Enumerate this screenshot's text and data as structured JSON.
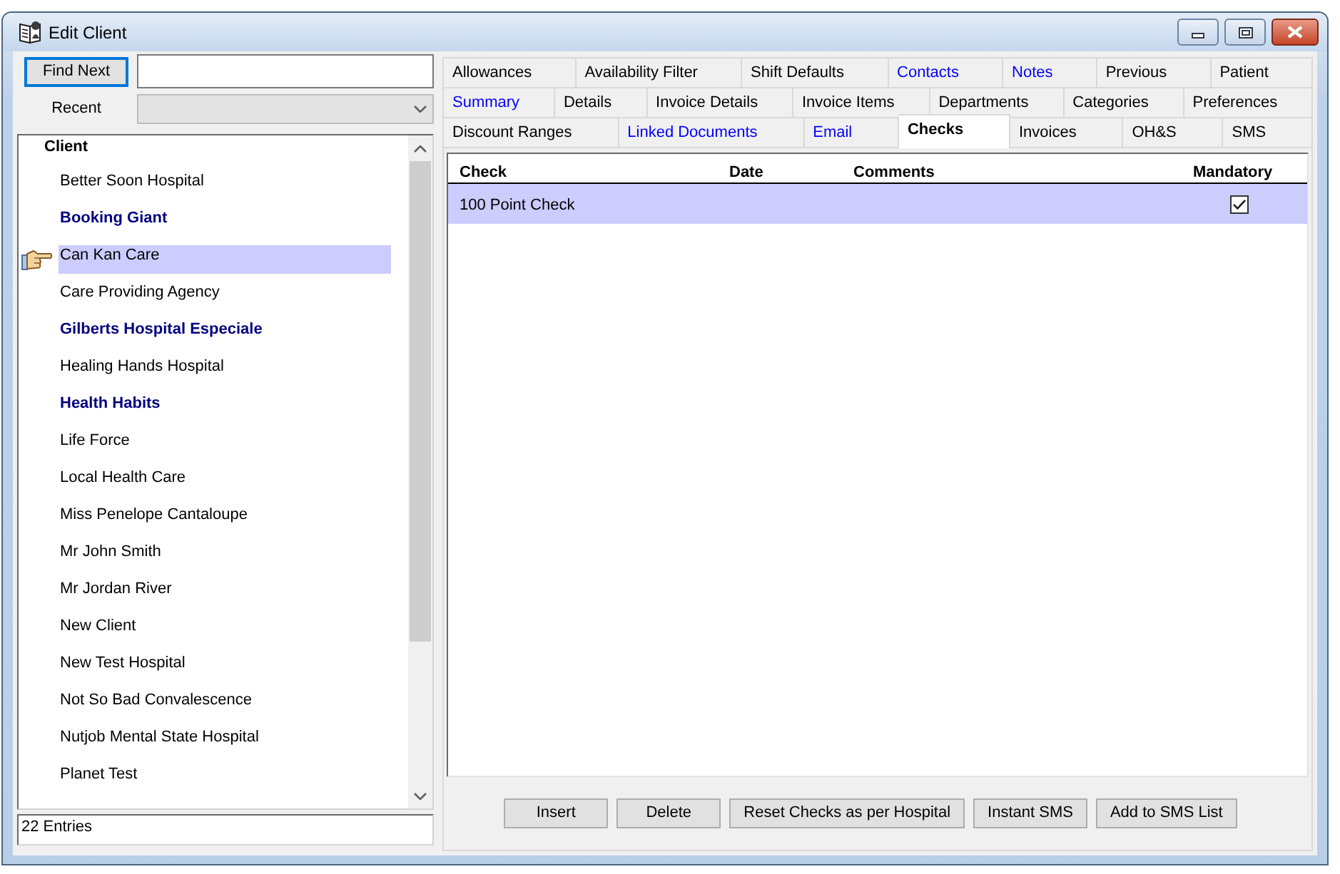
{
  "window": {
    "title": "Edit Client"
  },
  "search": {
    "button_label": "Find Next",
    "focused": true
  },
  "recent": {
    "label": "Recent",
    "disabled": true
  },
  "client_list": {
    "header": "Client",
    "items": [
      {
        "name": "Better Soon Hospital",
        "emphasized": false,
        "selected": false
      },
      {
        "name": "Booking Giant",
        "emphasized": true,
        "selected": false
      },
      {
        "name": "Can Kan Care",
        "emphasized": false,
        "selected": true
      },
      {
        "name": "Care Providing Agency",
        "emphasized": false,
        "selected": false
      },
      {
        "name": "Gilberts Hospital Especiale",
        "emphasized": true,
        "selected": false
      },
      {
        "name": "Healing Hands Hospital",
        "emphasized": false,
        "selected": false
      },
      {
        "name": "Health Habits",
        "emphasized": true,
        "selected": false
      },
      {
        "name": "Life Force",
        "emphasized": false,
        "selected": false
      },
      {
        "name": "Local Health Care",
        "emphasized": false,
        "selected": false
      },
      {
        "name": "Miss Penelope Cantaloupe",
        "emphasized": false,
        "selected": false
      },
      {
        "name": "Mr John Smith",
        "emphasized": false,
        "selected": false
      },
      {
        "name": "Mr Jordan River",
        "emphasized": false,
        "selected": false
      },
      {
        "name": "New Client",
        "emphasized": false,
        "selected": false
      },
      {
        "name": "New Test Hospital",
        "emphasized": false,
        "selected": false
      },
      {
        "name": "Not So Bad Convalescence",
        "emphasized": false,
        "selected": false
      },
      {
        "name": "Nutjob Mental State Hospital",
        "emphasized": false,
        "selected": false
      },
      {
        "name": "Planet Test",
        "emphasized": false,
        "selected": false
      }
    ],
    "entry_count": "22 Entries"
  },
  "tabs": {
    "rows": [
      [
        {
          "label": "Allowances",
          "highlighted": false,
          "selected": false
        },
        {
          "label": "Availability Filter",
          "highlighted": false,
          "selected": false
        },
        {
          "label": "Shift Defaults",
          "highlighted": false,
          "selected": false
        },
        {
          "label": "Contacts",
          "highlighted": true,
          "selected": false
        },
        {
          "label": "Notes",
          "highlighted": true,
          "selected": false
        },
        {
          "label": "Previous",
          "highlighted": false,
          "selected": false
        },
        {
          "label": "Patient",
          "highlighted": false,
          "selected": false
        }
      ],
      [
        {
          "label": "Summary",
          "highlighted": true,
          "selected": false
        },
        {
          "label": "Details",
          "highlighted": false,
          "selected": false
        },
        {
          "label": "Invoice Details",
          "highlighted": false,
          "selected": false
        },
        {
          "label": "Invoice Items",
          "highlighted": false,
          "selected": false
        },
        {
          "label": "Departments",
          "highlighted": false,
          "selected": false
        },
        {
          "label": "Categories",
          "highlighted": false,
          "selected": false
        },
        {
          "label": "Preferences",
          "highlighted": false,
          "selected": false
        }
      ],
      [
        {
          "label": "Discount Ranges",
          "highlighted": false,
          "selected": false
        },
        {
          "label": "Linked Documents",
          "highlighted": true,
          "selected": false
        },
        {
          "label": "Email",
          "highlighted": true,
          "selected": false
        },
        {
          "label": "Checks",
          "highlighted": false,
          "selected": true
        },
        {
          "label": "Invoices",
          "highlighted": false,
          "selected": false
        },
        {
          "label": "OH&S",
          "highlighted": false,
          "selected": false
        },
        {
          "label": "SMS",
          "highlighted": false,
          "selected": false
        }
      ]
    ]
  },
  "checks_table": {
    "columns": [
      "Check",
      "Date",
      "Comments",
      "Mandatory"
    ],
    "rows": [
      {
        "check": "100 Point Check",
        "mandatory": true,
        "selected": true
      }
    ]
  },
  "buttons": [
    "Insert",
    "Delete",
    "Reset Checks as per Hospital",
    "Instant SMS",
    "Add to SMS List"
  ]
}
